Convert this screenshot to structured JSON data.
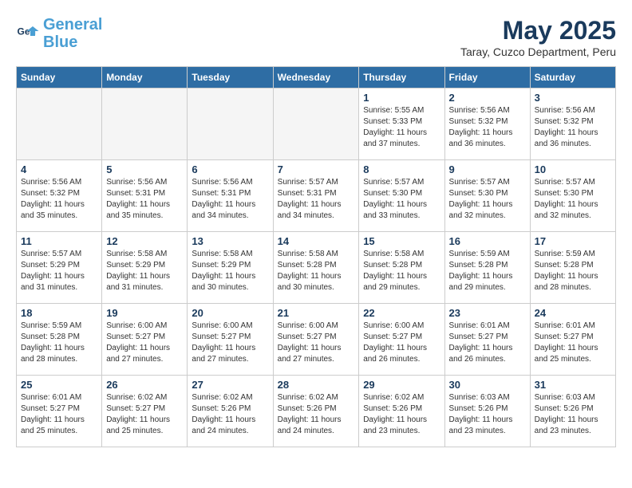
{
  "header": {
    "logo_line1": "General",
    "logo_line2": "Blue",
    "month_title": "May 2025",
    "subtitle": "Taray, Cuzco Department, Peru"
  },
  "days_of_week": [
    "Sunday",
    "Monday",
    "Tuesday",
    "Wednesday",
    "Thursday",
    "Friday",
    "Saturday"
  ],
  "weeks": [
    [
      {
        "day": "",
        "info": ""
      },
      {
        "day": "",
        "info": ""
      },
      {
        "day": "",
        "info": ""
      },
      {
        "day": "",
        "info": ""
      },
      {
        "day": "1",
        "sunrise": "5:55 AM",
        "sunset": "5:33 PM",
        "daylight": "11 hours and 37 minutes."
      },
      {
        "day": "2",
        "sunrise": "5:56 AM",
        "sunset": "5:32 PM",
        "daylight": "11 hours and 36 minutes."
      },
      {
        "day": "3",
        "sunrise": "5:56 AM",
        "sunset": "5:32 PM",
        "daylight": "11 hours and 36 minutes."
      }
    ],
    [
      {
        "day": "4",
        "sunrise": "5:56 AM",
        "sunset": "5:32 PM",
        "daylight": "11 hours and 35 minutes."
      },
      {
        "day": "5",
        "sunrise": "5:56 AM",
        "sunset": "5:31 PM",
        "daylight": "11 hours and 35 minutes."
      },
      {
        "day": "6",
        "sunrise": "5:56 AM",
        "sunset": "5:31 PM",
        "daylight": "11 hours and 34 minutes."
      },
      {
        "day": "7",
        "sunrise": "5:57 AM",
        "sunset": "5:31 PM",
        "daylight": "11 hours and 34 minutes."
      },
      {
        "day": "8",
        "sunrise": "5:57 AM",
        "sunset": "5:30 PM",
        "daylight": "11 hours and 33 minutes."
      },
      {
        "day": "9",
        "sunrise": "5:57 AM",
        "sunset": "5:30 PM",
        "daylight": "11 hours and 32 minutes."
      },
      {
        "day": "10",
        "sunrise": "5:57 AM",
        "sunset": "5:30 PM",
        "daylight": "11 hours and 32 minutes."
      }
    ],
    [
      {
        "day": "11",
        "sunrise": "5:57 AM",
        "sunset": "5:29 PM",
        "daylight": "11 hours and 31 minutes."
      },
      {
        "day": "12",
        "sunrise": "5:58 AM",
        "sunset": "5:29 PM",
        "daylight": "11 hours and 31 minutes."
      },
      {
        "day": "13",
        "sunrise": "5:58 AM",
        "sunset": "5:29 PM",
        "daylight": "11 hours and 30 minutes."
      },
      {
        "day": "14",
        "sunrise": "5:58 AM",
        "sunset": "5:28 PM",
        "daylight": "11 hours and 30 minutes."
      },
      {
        "day": "15",
        "sunrise": "5:58 AM",
        "sunset": "5:28 PM",
        "daylight": "11 hours and 29 minutes."
      },
      {
        "day": "16",
        "sunrise": "5:59 AM",
        "sunset": "5:28 PM",
        "daylight": "11 hours and 29 minutes."
      },
      {
        "day": "17",
        "sunrise": "5:59 AM",
        "sunset": "5:28 PM",
        "daylight": "11 hours and 28 minutes."
      }
    ],
    [
      {
        "day": "18",
        "sunrise": "5:59 AM",
        "sunset": "5:28 PM",
        "daylight": "11 hours and 28 minutes."
      },
      {
        "day": "19",
        "sunrise": "6:00 AM",
        "sunset": "5:27 PM",
        "daylight": "11 hours and 27 minutes."
      },
      {
        "day": "20",
        "sunrise": "6:00 AM",
        "sunset": "5:27 PM",
        "daylight": "11 hours and 27 minutes."
      },
      {
        "day": "21",
        "sunrise": "6:00 AM",
        "sunset": "5:27 PM",
        "daylight": "11 hours and 27 minutes."
      },
      {
        "day": "22",
        "sunrise": "6:00 AM",
        "sunset": "5:27 PM",
        "daylight": "11 hours and 26 minutes."
      },
      {
        "day": "23",
        "sunrise": "6:01 AM",
        "sunset": "5:27 PM",
        "daylight": "11 hours and 26 minutes."
      },
      {
        "day": "24",
        "sunrise": "6:01 AM",
        "sunset": "5:27 PM",
        "daylight": "11 hours and 25 minutes."
      }
    ],
    [
      {
        "day": "25",
        "sunrise": "6:01 AM",
        "sunset": "5:27 PM",
        "daylight": "11 hours and 25 minutes."
      },
      {
        "day": "26",
        "sunrise": "6:02 AM",
        "sunset": "5:27 PM",
        "daylight": "11 hours and 25 minutes."
      },
      {
        "day": "27",
        "sunrise": "6:02 AM",
        "sunset": "5:26 PM",
        "daylight": "11 hours and 24 minutes."
      },
      {
        "day": "28",
        "sunrise": "6:02 AM",
        "sunset": "5:26 PM",
        "daylight": "11 hours and 24 minutes."
      },
      {
        "day": "29",
        "sunrise": "6:02 AM",
        "sunset": "5:26 PM",
        "daylight": "11 hours and 23 minutes."
      },
      {
        "day": "30",
        "sunrise": "6:03 AM",
        "sunset": "5:26 PM",
        "daylight": "11 hours and 23 minutes."
      },
      {
        "day": "31",
        "sunrise": "6:03 AM",
        "sunset": "5:26 PM",
        "daylight": "11 hours and 23 minutes."
      }
    ]
  ]
}
